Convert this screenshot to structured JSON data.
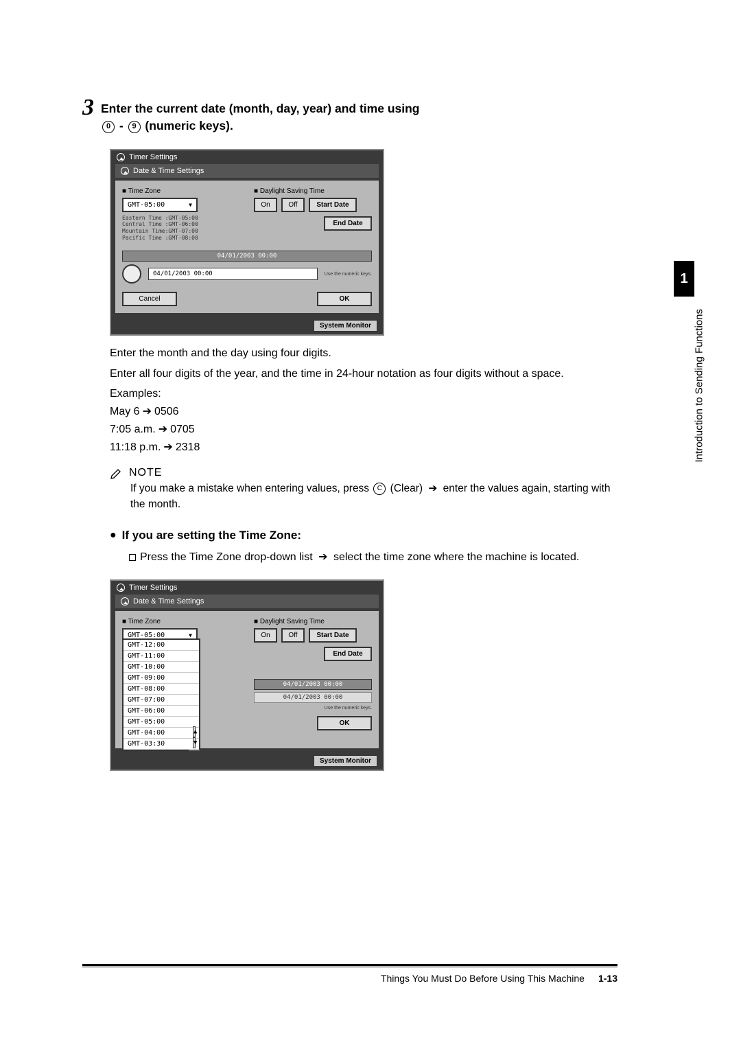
{
  "step": {
    "number": "3",
    "line1": "Enter the current date (month, day, year) and time using",
    "key0": "0",
    "dash": " - ",
    "key9": "9",
    "line2": "  (numeric keys)."
  },
  "screenshot1": {
    "title": "Timer Settings",
    "subtitle": "Date & Time Settings",
    "tz_label": "■ Time Zone",
    "tz_value": "GMT-05:00",
    "tz_list": "Eastern Time :GMT-05:00\nCentral Time :GMT-06:00\nMountain Time:GMT-07:00\nPacific Time :GMT-08:00",
    "dst_label": "■ Daylight Saving Time",
    "on": "On",
    "off": "Off",
    "start_date": "Start Date",
    "end_date": "End Date",
    "date_bar": "04/01/2003 00:00",
    "date_input": "04/01/2003 00:00",
    "hint": "Use the numeric\nkeys.",
    "cancel": "Cancel",
    "ok": "OK",
    "sysmon": "System Monitor"
  },
  "text": {
    "p1": "Enter the month and the day using four digits.",
    "p2": "Enter all four digits of the year, and the time in 24-hour notation as four digits without a space.",
    "examples_label": "Examples:",
    "ex1_a": "May 6",
    "ex1_b": "0506",
    "ex2_a": "7:05 a.m.",
    "ex2_b": "0705",
    "ex3_a": "11:18 p.m.",
    "ex3_b": "2318"
  },
  "note": {
    "label": "NOTE",
    "body_a": "If you make a mistake when entering values, press ",
    "clear": "C",
    "body_b": " (Clear) ",
    "body_c": " enter the values again, starting with the month."
  },
  "sub": {
    "heading": "If you are setting the Time Zone:",
    "item_a": "Press the Time Zone drop-down list ",
    "item_b": " select the time zone where the machine is located."
  },
  "screenshot2": {
    "title": "Timer Settings",
    "subtitle": "Date & Time Settings",
    "tz_label": "■ Time Zone",
    "tz_value": "GMT-05:00",
    "options": [
      "GMT-12:00",
      "GMT-11:00",
      "GMT-10:00",
      "GMT-09:00",
      "GMT-08:00",
      "GMT-07:00",
      "GMT-06:00",
      "GMT-05:00",
      "GMT-04:00",
      "GMT-03:30"
    ],
    "dst_label": "■ Daylight Saving Time",
    "on": "On",
    "off": "Off",
    "start_date": "Start Date",
    "end_date": "End Date",
    "date_bar": "04/01/2003 00:00",
    "date_input": "04/01/2003 00:00",
    "hint": "Use the numeric\nkeys.",
    "ok": "OK",
    "sysmon": "System Monitor"
  },
  "side": {
    "chapter": "1",
    "label": "Introduction to Sending Functions"
  },
  "footer": {
    "section": "Things You Must Do Before Using This Machine",
    "page": "1-13"
  }
}
